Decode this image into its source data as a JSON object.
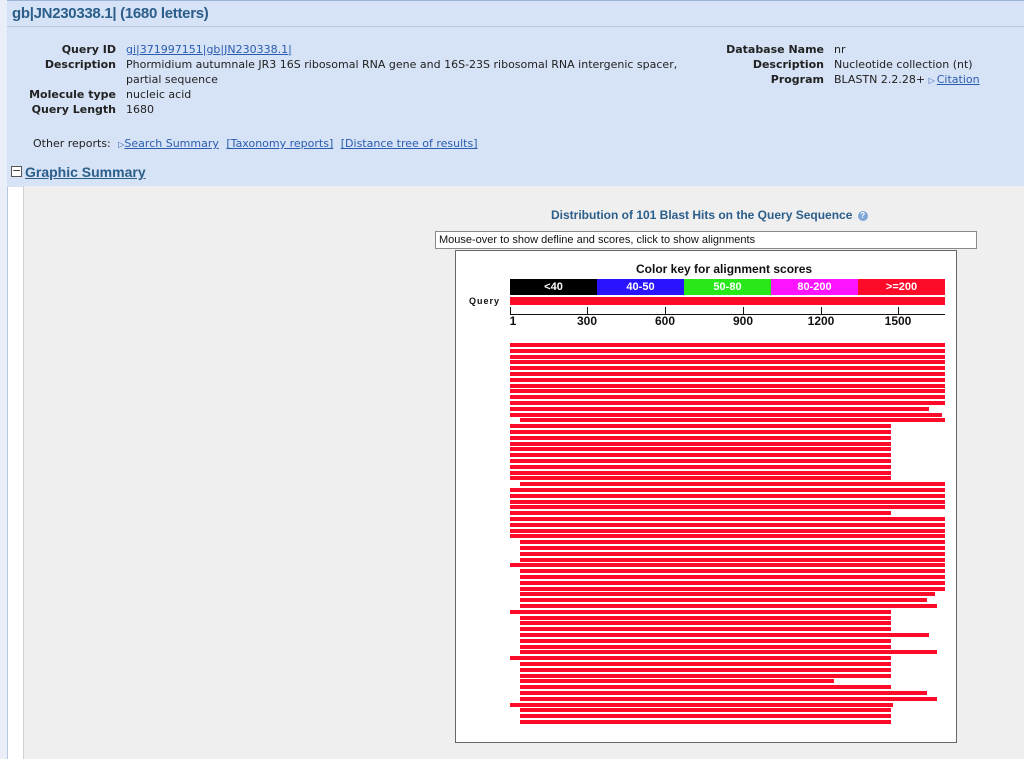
{
  "title": "gb|JN230338.1| (1680 letters)",
  "query_info": {
    "query_id_label": "Query ID",
    "query_id": "gi|371997151|gb|JN230338.1|",
    "description_label": "Description",
    "description": "Phormidium autumnale JR3 16S ribosomal RNA gene and 16S-23S ribosomal RNA intergenic spacer, partial sequence",
    "molecule_type_label": "Molecule type",
    "molecule_type": "nucleic acid",
    "query_length_label": "Query Length",
    "query_length": "1680"
  },
  "db_info": {
    "database_name_label": "Database Name",
    "database_name": "nr",
    "description_label": "Description",
    "description": "Nucleotide collection (nt)",
    "program_label": "Program",
    "program": "BLASTN 2.2.28+",
    "citation": "Citation"
  },
  "other_reports": {
    "label": "Other reports:",
    "search_summary": "Search Summary",
    "taxonomy": "[Taxonomy reports]",
    "distance_tree": "[Distance tree of results]"
  },
  "graphic_summary": {
    "heading": "Graphic Summary",
    "toggle": "−",
    "distribution_title": "Distribution of 101 Blast Hits on the Query Sequence",
    "help_icon": "?",
    "defline_placeholder": "Mouse-over to show defline and scores, click to show alignments",
    "color_key_title": "Color key for alignment scores",
    "query_label": "Query"
  },
  "chart_data": {
    "type": "bar",
    "title": "Color key for alignment scores",
    "query_length": 1680,
    "color_key": [
      {
        "label": "<40",
        "color": "#000000"
      },
      {
        "label": "40-50",
        "color": "#2a14ff"
      },
      {
        "label": "50-80",
        "color": "#29e81a"
      },
      {
        "label": "80-200",
        "color": "#ff14ff"
      },
      {
        "label": ">=200",
        "color": "#ff0b2a"
      }
    ],
    "x_ticks": [
      1,
      300,
      600,
      900,
      1200,
      1500
    ],
    "xlim": [
      1,
      1680
    ],
    "hit_color": "#ff0b2a",
    "hits": [
      [
        1,
        1680
      ],
      [
        1,
        1680
      ],
      [
        1,
        1680
      ],
      [
        1,
        1680
      ],
      [
        1,
        1680
      ],
      [
        1,
        1680
      ],
      [
        1,
        1680
      ],
      [
        1,
        1680
      ],
      [
        1,
        1680
      ],
      [
        1,
        1680
      ],
      [
        1,
        1680
      ],
      [
        1,
        1620
      ],
      [
        1,
        1670
      ],
      [
        40,
        1680
      ],
      [
        1,
        1470
      ],
      [
        1,
        1470
      ],
      [
        1,
        1470
      ],
      [
        1,
        1470
      ],
      [
        1,
        1470
      ],
      [
        1,
        1470
      ],
      [
        1,
        1470
      ],
      [
        1,
        1470
      ],
      [
        1,
        1470
      ],
      [
        1,
        1470
      ],
      [
        40,
        1680
      ],
      [
        1,
        1680
      ],
      [
        1,
        1680
      ],
      [
        1,
        1680
      ],
      [
        1,
        1680
      ],
      [
        1,
        1470
      ],
      [
        1,
        1680
      ],
      [
        1,
        1680
      ],
      [
        1,
        1680
      ],
      [
        1,
        1680
      ],
      [
        40,
        1680
      ],
      [
        40,
        1680
      ],
      [
        40,
        1680
      ],
      [
        40,
        1680
      ],
      [
        1,
        1680
      ],
      [
        40,
        1680
      ],
      [
        40,
        1680
      ],
      [
        40,
        1680
      ],
      [
        40,
        1680
      ],
      [
        40,
        1640
      ],
      [
        40,
        1610
      ],
      [
        40,
        1650
      ],
      [
        1,
        1470
      ],
      [
        40,
        1470
      ],
      [
        40,
        1470
      ],
      [
        40,
        1470
      ],
      [
        40,
        1620
      ],
      [
        40,
        1470
      ],
      [
        40,
        1470
      ],
      [
        40,
        1650
      ],
      [
        1,
        1470
      ],
      [
        40,
        1470
      ],
      [
        40,
        1470
      ],
      [
        40,
        1470
      ],
      [
        40,
        1250
      ],
      [
        40,
        1470
      ],
      [
        40,
        1610
      ],
      [
        40,
        1650
      ],
      [
        1,
        1480
      ],
      [
        40,
        1470
      ],
      [
        40,
        1470
      ],
      [
        40,
        1470
      ]
    ]
  }
}
